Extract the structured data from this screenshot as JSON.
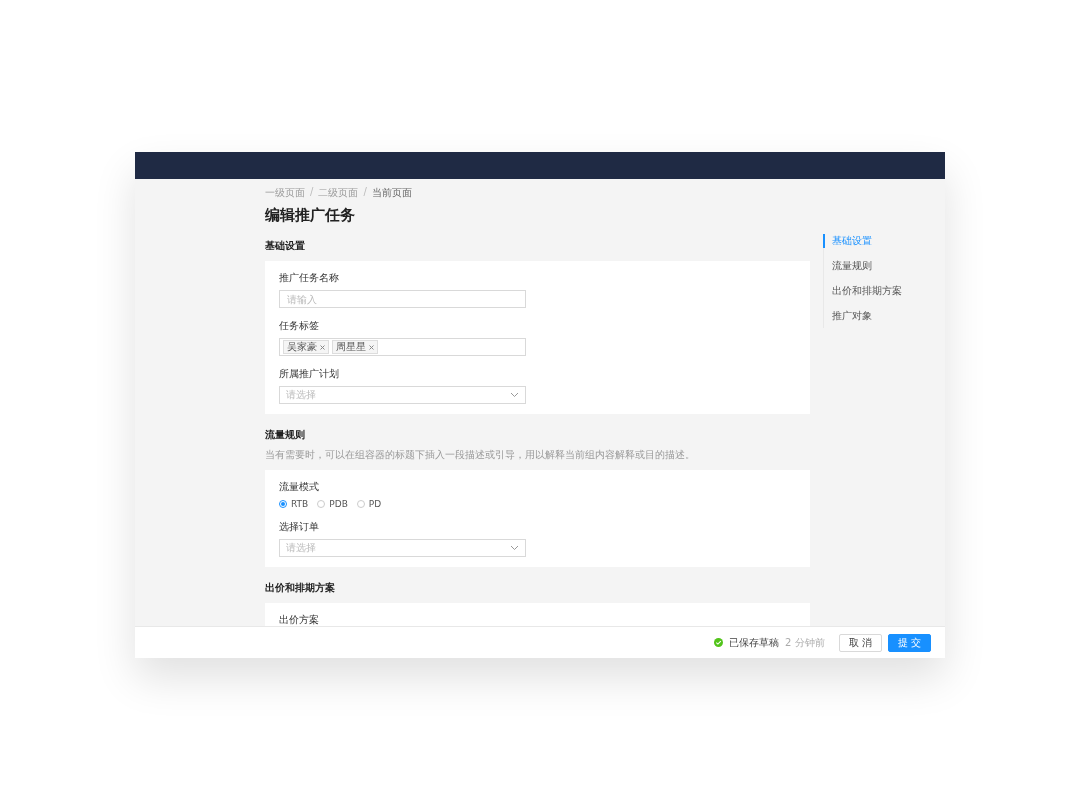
{
  "breadcrumb": [
    {
      "label": "一级页面",
      "separator": "/"
    },
    {
      "label": "二级页面",
      "separator": "/"
    },
    {
      "label": "当前页面"
    }
  ],
  "title": "编辑推广任务",
  "sections": [
    {
      "title": "基础设置",
      "fields": [
        {
          "kind": "input",
          "label": "推广任务名称",
          "placeholder": "请输入"
        },
        {
          "kind": "tags",
          "label": "任务标签",
          "tags": [
            "吴家豪",
            "周星星"
          ]
        },
        {
          "kind": "select",
          "label": "所属推广计划",
          "placeholder": "请选择"
        }
      ]
    },
    {
      "title": "流量规则",
      "description": "当有需要时，可以在组容器的标题下插入一段描述或引导，用以解释当前组内容解释或目的描述。",
      "fields": [
        {
          "kind": "radio",
          "label": "流量模式",
          "options": [
            {
              "label": "RTB",
              "selected": true
            },
            {
              "label": "PDB",
              "selected": false
            },
            {
              "label": "PD",
              "selected": false
            }
          ]
        },
        {
          "kind": "select",
          "label": "选择订单",
          "placeholder": "请选择"
        }
      ]
    },
    {
      "title": "出价和排期方案",
      "fields": [
        {
          "kind": "label",
          "label": "出价方案"
        }
      ]
    }
  ],
  "anchor": [
    {
      "label": "基础设置",
      "selected": true
    },
    {
      "label": "流量规则",
      "selected": false
    },
    {
      "label": "出价和排期方案",
      "selected": false
    },
    {
      "label": "推广对象",
      "selected": false
    }
  ],
  "footer": {
    "status": "已保存草稿",
    "time": "2 分钟前",
    "buttons": [
      {
        "label": "取 消",
        "kind": "default"
      },
      {
        "label": "提 交",
        "kind": "primary"
      }
    ]
  }
}
